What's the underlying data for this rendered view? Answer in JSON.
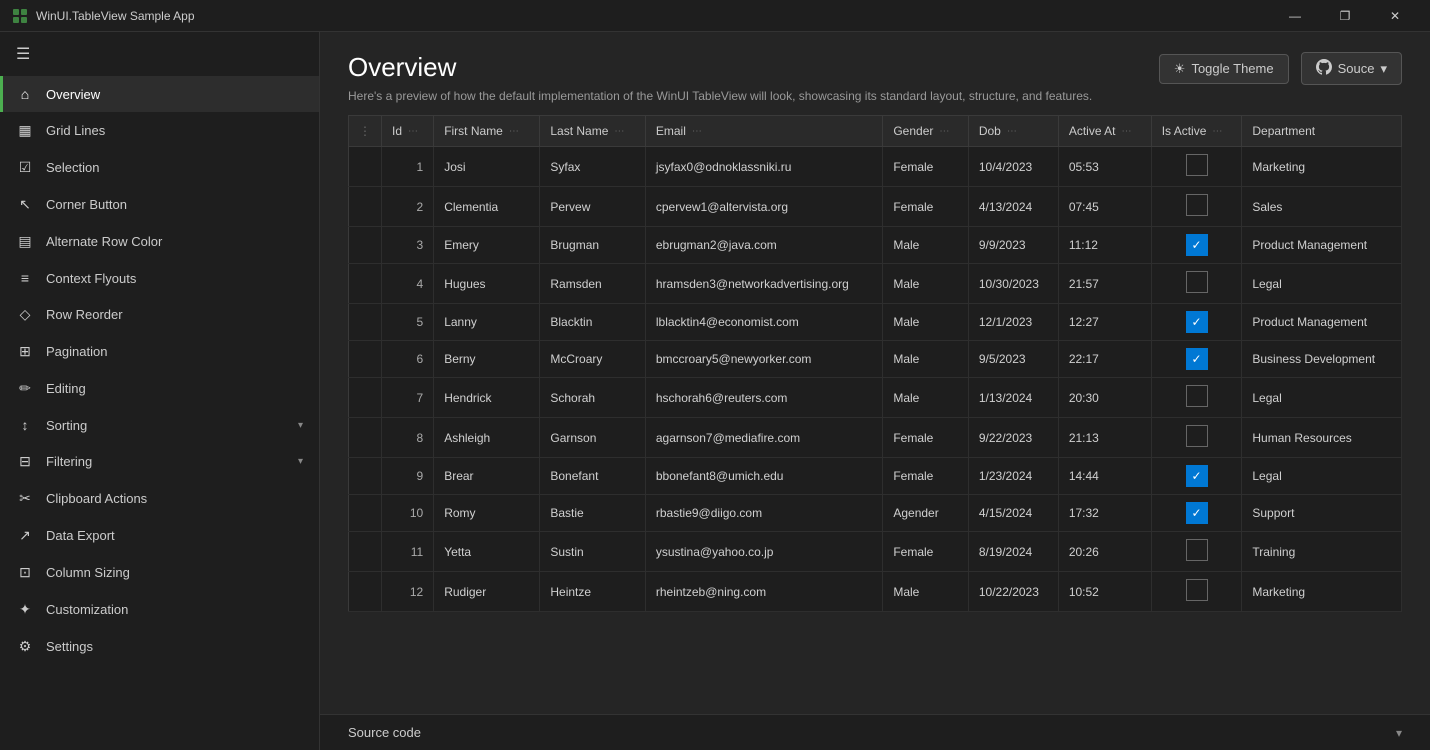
{
  "titlebar": {
    "title": "WinUI.TableView Sample App",
    "minimize": "—",
    "maximize": "❐",
    "close": "✕"
  },
  "sidebar": {
    "hamburger": "☰",
    "items": [
      {
        "id": "overview",
        "label": "Overview",
        "icon": "⌂",
        "active": true
      },
      {
        "id": "grid-lines",
        "label": "Grid Lines",
        "icon": "▦",
        "active": false
      },
      {
        "id": "selection",
        "label": "Selection",
        "icon": "☑",
        "active": false
      },
      {
        "id": "corner-button",
        "label": "Corner Button",
        "icon": "↖",
        "active": false
      },
      {
        "id": "alternate-row-color",
        "label": "Alternate Row Color",
        "icon": "▤",
        "active": false
      },
      {
        "id": "context-flyouts",
        "label": "Context Flyouts",
        "icon": "≡",
        "active": false
      },
      {
        "id": "row-reorder",
        "label": "Row Reorder",
        "icon": "◇",
        "active": false
      },
      {
        "id": "pagination",
        "label": "Pagination",
        "icon": "⊞",
        "active": false
      },
      {
        "id": "editing",
        "label": "Editing",
        "icon": "✏",
        "active": false
      },
      {
        "id": "sorting",
        "label": "Sorting",
        "icon": "↕",
        "active": false,
        "hasChevron": true
      },
      {
        "id": "filtering",
        "label": "Filtering",
        "icon": "⊟",
        "active": false,
        "hasChevron": true
      },
      {
        "id": "clipboard-actions",
        "label": "Clipboard Actions",
        "icon": "✂",
        "active": false
      },
      {
        "id": "data-export",
        "label": "Data Export",
        "icon": "↗",
        "active": false
      },
      {
        "id": "column-sizing",
        "label": "Column Sizing",
        "icon": "⊡",
        "active": false
      },
      {
        "id": "customization",
        "label": "Customization",
        "icon": "✦",
        "active": false
      },
      {
        "id": "settings",
        "label": "Settings",
        "icon": "⚙",
        "active": false
      }
    ]
  },
  "main": {
    "title": "Overview",
    "subtitle": "Here's a preview of how the default implementation of the WinUI TableView will look, showcasing its standard layout, structure, and features.",
    "toggle_theme_label": "Toggle Theme",
    "source_label": "Souce",
    "source_chevron": "▾"
  },
  "table": {
    "columns": [
      {
        "id": "dots",
        "label": "⋮",
        "hasDots": false
      },
      {
        "id": "id",
        "label": "Id",
        "hasDots": true
      },
      {
        "id": "first_name",
        "label": "First Name",
        "hasDots": true
      },
      {
        "id": "last_name",
        "label": "Last Name",
        "hasDots": true
      },
      {
        "id": "email",
        "label": "Email",
        "hasDots": true
      },
      {
        "id": "gender",
        "label": "Gender",
        "hasDots": true
      },
      {
        "id": "dob",
        "label": "Dob",
        "hasDots": true
      },
      {
        "id": "active_at",
        "label": "Active At",
        "hasDots": true
      },
      {
        "id": "is_active",
        "label": "Is Active",
        "hasDots": true
      },
      {
        "id": "department",
        "label": "Department",
        "hasDots": false
      }
    ],
    "rows": [
      {
        "id": 1,
        "first_name": "Josi",
        "last_name": "Syfax",
        "email": "jsyfax0@odnoklassniki.ru",
        "gender": "Female",
        "dob": "10/4/2023",
        "active_at": "05:53",
        "is_active": false,
        "department": "Marketing"
      },
      {
        "id": 2,
        "first_name": "Clementia",
        "last_name": "Pervew",
        "email": "cpervew1@altervista.org",
        "gender": "Female",
        "dob": "4/13/2024",
        "active_at": "07:45",
        "is_active": false,
        "department": "Sales"
      },
      {
        "id": 3,
        "first_name": "Emery",
        "last_name": "Brugman",
        "email": "ebrugman2@java.com",
        "gender": "Male",
        "dob": "9/9/2023",
        "active_at": "11:12",
        "is_active": true,
        "department": "Product Management"
      },
      {
        "id": 4,
        "first_name": "Hugues",
        "last_name": "Ramsden",
        "email": "hramsden3@networkadvertising.org",
        "gender": "Male",
        "dob": "10/30/2023",
        "active_at": "21:57",
        "is_active": false,
        "department": "Legal"
      },
      {
        "id": 5,
        "first_name": "Lanny",
        "last_name": "Blacktin",
        "email": "lblacktin4@economist.com",
        "gender": "Male",
        "dob": "12/1/2023",
        "active_at": "12:27",
        "is_active": true,
        "department": "Product Management"
      },
      {
        "id": 6,
        "first_name": "Berny",
        "last_name": "McCroary",
        "email": "bmccroary5@newyorker.com",
        "gender": "Male",
        "dob": "9/5/2023",
        "active_at": "22:17",
        "is_active": true,
        "department": "Business Development"
      },
      {
        "id": 7,
        "first_name": "Hendrick",
        "last_name": "Schorah",
        "email": "hschorah6@reuters.com",
        "gender": "Male",
        "dob": "1/13/2024",
        "active_at": "20:30",
        "is_active": false,
        "department": "Legal"
      },
      {
        "id": 8,
        "first_name": "Ashleigh",
        "last_name": "Garnson",
        "email": "agarnson7@mediafire.com",
        "gender": "Female",
        "dob": "9/22/2023",
        "active_at": "21:13",
        "is_active": false,
        "department": "Human Resources"
      },
      {
        "id": 9,
        "first_name": "Brear",
        "last_name": "Bonefant",
        "email": "bbonefant8@umich.edu",
        "gender": "Female",
        "dob": "1/23/2024",
        "active_at": "14:44",
        "is_active": true,
        "department": "Legal"
      },
      {
        "id": 10,
        "first_name": "Romy",
        "last_name": "Bastie",
        "email": "rbastie9@diigo.com",
        "gender": "Agender",
        "dob": "4/15/2024",
        "active_at": "17:32",
        "is_active": true,
        "department": "Support"
      },
      {
        "id": 11,
        "first_name": "Yetta",
        "last_name": "Sustin",
        "email": "ysustina@yahoo.co.jp",
        "gender": "Female",
        "dob": "8/19/2024",
        "active_at": "20:26",
        "is_active": false,
        "department": "Training"
      },
      {
        "id": 12,
        "first_name": "Rudiger",
        "last_name": "Heintze",
        "email": "rheintzeb@ning.com",
        "gender": "Male",
        "dob": "10/22/2023",
        "active_at": "10:52",
        "is_active": false,
        "department": "Marketing"
      }
    ]
  },
  "source_bar": {
    "label": "Source code",
    "chevron": "▾"
  }
}
